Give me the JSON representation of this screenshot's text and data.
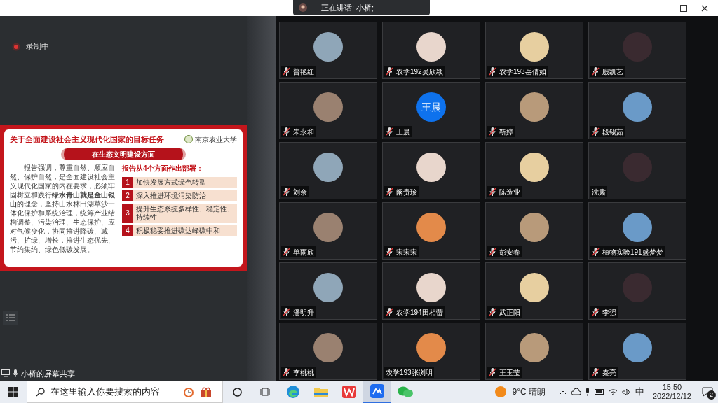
{
  "speaking": {
    "text": "正在讲话: 小桥;"
  },
  "recording": {
    "label": "录制中"
  },
  "slide": {
    "title": "关于全面建设社会主义现代化国家的目标任务",
    "logo": "南京农业大学",
    "banner": "在生态文明建设方面",
    "paragraph": "报告强调，尊重自然、顺应自然、保护自然，是全面建设社会主义现代化国家的内在要求，必须牢固树立和践行**绿水青山就是金山银山**的理念，坚持山水林田湖草沙一体化保护和系统治理，统筹产业结构调整、污染治理、生态保护、应对气候变化，协同推进降碳、减污、扩绿、增长，推进生态优先、节约集约、绿色低碳发展。",
    "subtitle": "报告从4个方面作出部署：",
    "items": [
      {
        "number": "1",
        "text": "加快发展方式绿色转型"
      },
      {
        "number": "2",
        "text": "深入推进环境污染防治"
      },
      {
        "number": "3",
        "text": "提升生态系统多样性、稳定性、持续性"
      },
      {
        "number": "4",
        "text": "积极稳妥推进碳达峰碳中和"
      }
    ]
  },
  "share_label": "小桥的屏幕共享",
  "participants": [
    {
      "name": "普艳红",
      "muted": true,
      "kind": "photo"
    },
    {
      "name": "农学192吴欣颖",
      "muted": true,
      "kind": "photo"
    },
    {
      "name": "农学193岳倩如",
      "muted": true,
      "kind": "photo"
    },
    {
      "name": "殷凯艺",
      "muted": true,
      "kind": "photo"
    },
    {
      "name": "朱永和",
      "muted": true,
      "kind": "photo"
    },
    {
      "name": "王晨",
      "muted": true,
      "kind": "initials",
      "initials": "王晨"
    },
    {
      "name": "靳婷",
      "muted": true,
      "kind": "photo"
    },
    {
      "name": "段锡茹",
      "muted": true,
      "kind": "photo"
    },
    {
      "name": "刘余",
      "muted": true,
      "kind": "photo"
    },
    {
      "name": "阚贵珍",
      "muted": true,
      "kind": "photo"
    },
    {
      "name": "陈造业",
      "muted": true,
      "kind": "photo"
    },
    {
      "name": "沈肃",
      "muted": false,
      "kind": "photo"
    },
    {
      "name": "单雨欣",
      "muted": true,
      "kind": "photo"
    },
    {
      "name": "宋宋宋",
      "muted": true,
      "kind": "photo"
    },
    {
      "name": "彭安春",
      "muted": true,
      "kind": "photo"
    },
    {
      "name": "植物实验191盛梦梦",
      "muted": true,
      "kind": "photo"
    },
    {
      "name": "潘明升",
      "muted": true,
      "kind": "photo"
    },
    {
      "name": "农学194田相蕾",
      "muted": true,
      "kind": "photo"
    },
    {
      "name": "武正阳",
      "muted": true,
      "kind": "photo"
    },
    {
      "name": "李强",
      "muted": true,
      "kind": "photo"
    },
    {
      "name": "李桃桃",
      "muted": true,
      "kind": "photo"
    },
    {
      "name": "农学193张浏明",
      "muted": false,
      "kind": "photo"
    },
    {
      "name": "王玉莹",
      "muted": true,
      "kind": "photo"
    },
    {
      "name": "秦亮",
      "muted": true,
      "kind": "photo"
    }
  ],
  "taskbar": {
    "search_placeholder": "在这里输入你要搜索的内容",
    "weather": "9°C 晴朗",
    "ime": "中",
    "time": "15:50",
    "date": "2022/12/12",
    "notifications": "2"
  }
}
